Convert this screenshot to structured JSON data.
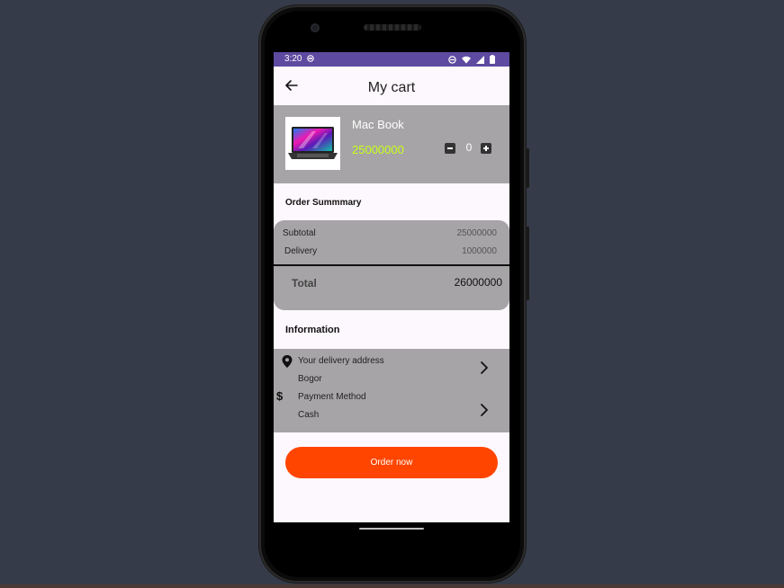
{
  "status_bar": {
    "time": "3:20",
    "icons": [
      "sync-icon",
      "dnd-icon",
      "wifi-icon",
      "signal-icon",
      "battery-icon"
    ],
    "color": "#5e4aa0"
  },
  "app_bar": {
    "title": "My cart",
    "back_icon": "arrow-left-icon"
  },
  "cart": {
    "items": [
      {
        "name": "Mac Book",
        "price": "25000000",
        "quantity": "0",
        "image": "laptop-image"
      }
    ]
  },
  "order_summary": {
    "title": "Order Summmary",
    "subtotal_label": "Subtotal",
    "subtotal_value": "25000000",
    "delivery_label": "Delivery",
    "delivery_value": "1000000",
    "total_label": "Total",
    "total_value": "26000000"
  },
  "information": {
    "title": "Information",
    "address_label": "Your delivery address",
    "address_value": "Bogor",
    "payment_label": "Payment Method",
    "payment_value": "Cash"
  },
  "actions": {
    "order_now": "Order now"
  },
  "colors": {
    "accent": "#ff4500",
    "price": "#c8ff1a",
    "card": "#a6a4a6",
    "background": "#353b48"
  }
}
